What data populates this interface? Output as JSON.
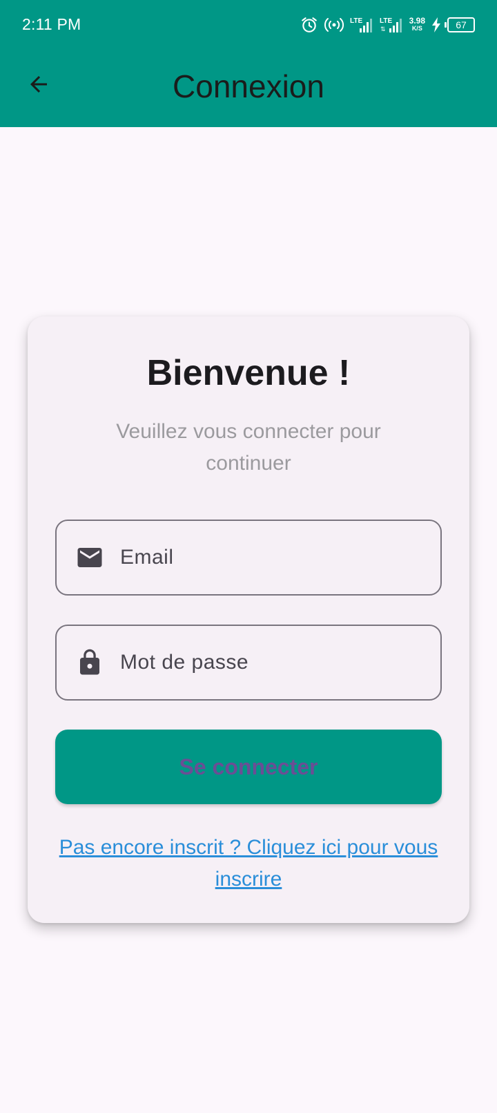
{
  "status_bar": {
    "time": "2:11 PM",
    "network_speed": "3.98",
    "network_speed_unit": "K/S",
    "battery_level": "67",
    "icons": [
      "alarm-icon",
      "hotspot-icon",
      "lte-signal-icon",
      "lte-signal-icon",
      "charging-icon",
      "battery-icon"
    ]
  },
  "app_bar": {
    "title": "Connexion",
    "back_icon": "arrow-back-icon"
  },
  "card": {
    "title": "Bienvenue !",
    "subtitle": "Veuillez vous connecter pour continuer",
    "email_field": {
      "label": "Email",
      "icon": "mail-icon"
    },
    "password_field": {
      "label": "Mot de passe",
      "icon": "lock-icon"
    },
    "login_button": "Se connecter",
    "signup_link": "Pas encore inscrit ? Cliquez ici pour vous inscrire"
  },
  "colors": {
    "primary": "#009786",
    "background": "#fcf7fc",
    "card": "#f6f0f6",
    "link": "#2a8ed9",
    "button_text": "#6b4e95"
  }
}
